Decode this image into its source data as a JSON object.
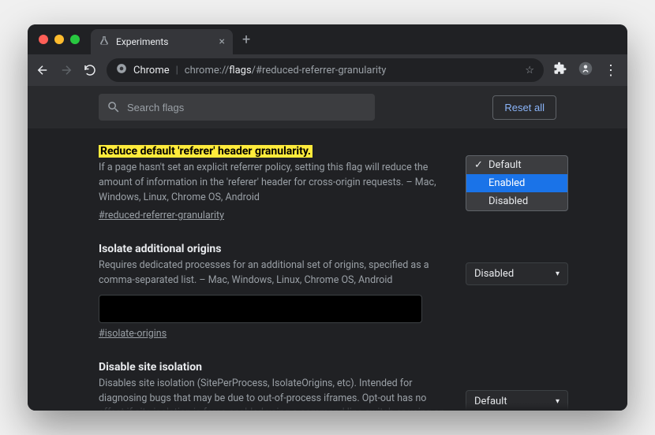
{
  "tab": {
    "title": "Experiments"
  },
  "omnibox": {
    "label": "Chrome",
    "url_prefix": "chrome://",
    "url_highlight": "flags",
    "url_suffix": "/#reduced-referrer-granularity"
  },
  "search": {
    "placeholder": "Search flags"
  },
  "reset_label": "Reset all",
  "flags": [
    {
      "title": "Reduce default 'referer' header granularity.",
      "desc": "If a page hasn't set an explicit referrer policy, setting this flag will reduce the amount of information in the 'referer' header for cross-origin requests. – Mac, Windows, Linux, Chrome OS, Android",
      "hash": "#reduced-referrer-granularity",
      "select": {
        "open": true,
        "options": [
          "Default",
          "Enabled",
          "Disabled"
        ],
        "selected": "Enabled",
        "checked": "Default"
      }
    },
    {
      "title": "Isolate additional origins",
      "desc": "Requires dedicated processes for an additional set of origins, specified as a comma-separated list. – Mac, Windows, Linux, Chrome OS, Android",
      "hash": "#isolate-origins",
      "select": {
        "value": "Disabled"
      }
    },
    {
      "title": "Disable site isolation",
      "desc": "Disables site isolation (SitePerProcess, IsolateOrigins, etc). Intended for diagnosing bugs that may be due to out-of-process iframes. Opt-out has no effect if site isolation is force-enabled using a command line switch or using an enterprise policy. Caution: this disables",
      "select": {
        "value": "Default"
      }
    }
  ]
}
